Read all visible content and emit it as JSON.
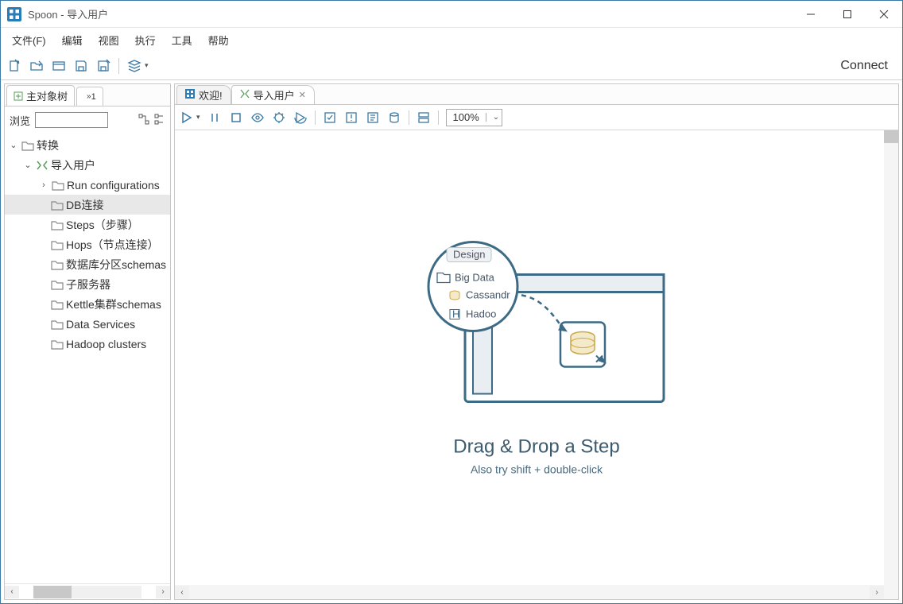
{
  "window": {
    "title": "Spoon - 导入用户"
  },
  "menubar": [
    "文件(F)",
    "编辑",
    "视图",
    "执行",
    "工具",
    "帮助"
  ],
  "toolbar_right": "Connect",
  "sidebar": {
    "tab_label": "主对象树",
    "tiny_tab": "1",
    "browse_label": "浏览",
    "tree": {
      "root": "转换",
      "job": "导入用户",
      "items": [
        "Run configurations",
        "DB连接",
        "Steps（步骤）",
        "Hops（节点连接）",
        "数据库分区schemas",
        "子服务器",
        "Kettle集群schemas",
        "Data Services",
        "Hadoop clusters"
      ]
    }
  },
  "main": {
    "tabs": {
      "welcome": "欢迎!",
      "current": "导入用户"
    },
    "zoom": "100%",
    "illus": {
      "design_label": "Design",
      "row1": "Big Data",
      "row2": "Cassandra",
      "row3": "Hadoop",
      "title": "Drag & Drop a Step",
      "subtitle": "Also try shift + double-click"
    }
  }
}
